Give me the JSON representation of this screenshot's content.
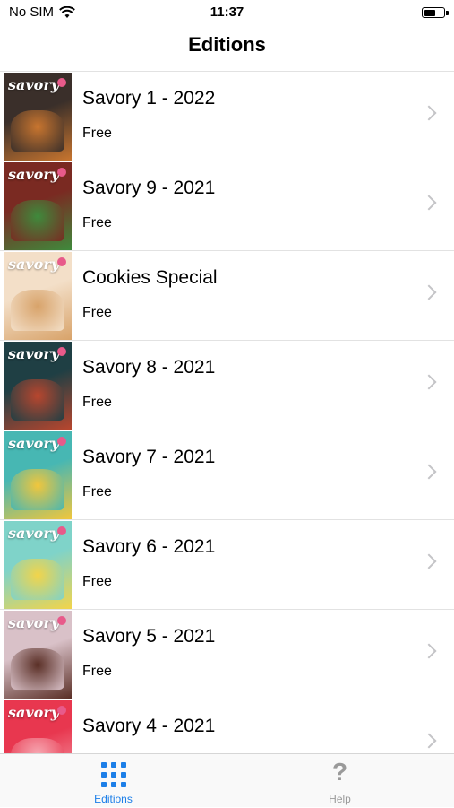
{
  "status_bar": {
    "carrier": "No SIM",
    "time": "11:37",
    "battery_level": 0.6
  },
  "nav": {
    "title": "Editions"
  },
  "editions": [
    {
      "title": "Savory 1 - 2022",
      "price": "Free",
      "cover_colors": [
        "#3a2f2a",
        "#c8752f"
      ]
    },
    {
      "title": "Savory 9 - 2021",
      "price": "Free",
      "cover_colors": [
        "#7a2a22",
        "#3f8a3c"
      ]
    },
    {
      "title": "Cookies Special",
      "price": "Free",
      "cover_colors": [
        "#f3dfc8",
        "#d8a36a"
      ]
    },
    {
      "title": "Savory 8 - 2021",
      "price": "Free",
      "cover_colors": [
        "#1f3f44",
        "#b8462e"
      ]
    },
    {
      "title": "Savory 7 - 2021",
      "price": "Free",
      "cover_colors": [
        "#47b7b3",
        "#f1c63c"
      ]
    },
    {
      "title": "Savory 6 - 2021",
      "price": "Free",
      "cover_colors": [
        "#7fd3c9",
        "#f2d44a"
      ]
    },
    {
      "title": "Savory 5 - 2021",
      "price": "Free",
      "cover_colors": [
        "#d9c1c8",
        "#5a2f26"
      ]
    },
    {
      "title": "Savory 4 - 2021",
      "price": "",
      "cover_colors": [
        "#e8374f",
        "#f7a9b3"
      ]
    }
  ],
  "cover_brand": "savory",
  "tabs": [
    {
      "label": "Editions",
      "icon": "grid-icon",
      "active": true,
      "color": "#1d7fe8"
    },
    {
      "label": "Help",
      "icon": "question-mark-icon",
      "active": false,
      "color": "#9a9a9a"
    }
  ]
}
